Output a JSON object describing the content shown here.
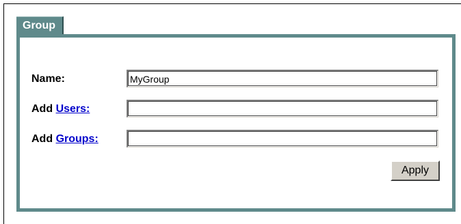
{
  "tab": {
    "label": "Group"
  },
  "form": {
    "name": {
      "label": "Name:",
      "value": "MyGroup"
    },
    "users": {
      "prefix": "Add",
      "link_label": "Users:",
      "value": ""
    },
    "groups": {
      "prefix": "Add",
      "link_label": "Groups:",
      "value": ""
    },
    "apply_label": "Apply"
  },
  "colors": {
    "tab_background": "#5f8a8b",
    "panel_border": "#5f8a8b",
    "link": "#0000cc",
    "button_face": "#d4d0c8"
  }
}
